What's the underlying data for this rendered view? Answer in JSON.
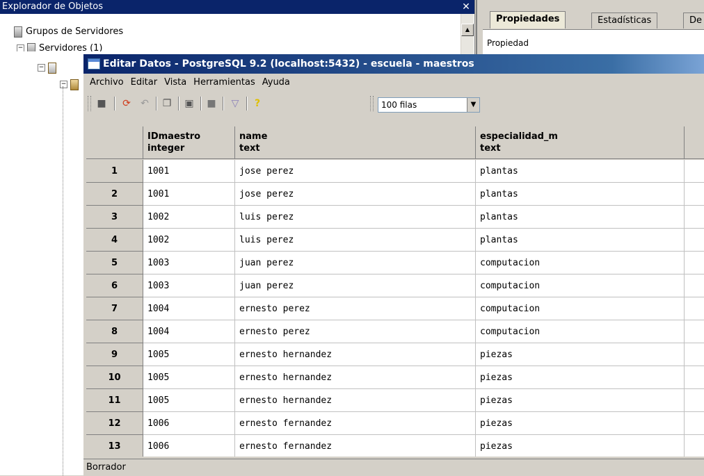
{
  "explorer": {
    "title": "Explorador de Objetos",
    "close_glyph": "✕",
    "tree": [
      {
        "label": "Grupos de Servidores"
      },
      {
        "label": "Servidores (1)"
      }
    ]
  },
  "properties": {
    "tabs": [
      "Propiedades",
      "Estadísticas",
      "De"
    ],
    "header": "Propiedad"
  },
  "editor": {
    "title": "Editar Datos - PostgreSQL 9.2 (localhost:5432) - escuela - maestros",
    "menu": [
      "Archivo",
      "Editar",
      "Vista",
      "Herramientas",
      "Ayuda"
    ],
    "toolbar": {
      "rows_limit": "100 filas"
    },
    "columns": [
      {
        "name": "IDmaestro",
        "type": "integer"
      },
      {
        "name": "name",
        "type": "text"
      },
      {
        "name": "especialidad_m",
        "type": "text"
      }
    ],
    "rows": [
      {
        "num": "1",
        "id": "1001",
        "name": "jose perez",
        "esp": "plantas"
      },
      {
        "num": "2",
        "id": "1001",
        "name": "jose perez",
        "esp": "plantas"
      },
      {
        "num": "3",
        "id": "1002",
        "name": "luis perez",
        "esp": "plantas"
      },
      {
        "num": "4",
        "id": "1002",
        "name": "luis perez",
        "esp": "plantas"
      },
      {
        "num": "5",
        "id": "1003",
        "name": "juan perez",
        "esp": "computacion"
      },
      {
        "num": "6",
        "id": "1003",
        "name": "juan perez",
        "esp": "computacion"
      },
      {
        "num": "7",
        "id": "1004",
        "name": "ernesto perez",
        "esp": "computacion"
      },
      {
        "num": "8",
        "id": "1004",
        "name": "ernesto perez",
        "esp": "computacion"
      },
      {
        "num": "9",
        "id": "1005",
        "name": "ernesto hernandez",
        "esp": "piezas"
      },
      {
        "num": "10",
        "id": "1005",
        "name": "ernesto hernandez",
        "esp": "piezas"
      },
      {
        "num": "11",
        "id": "1005",
        "name": "ernesto hernandez",
        "esp": "piezas"
      },
      {
        "num": "12",
        "id": "1006",
        "name": "ernesto fernandez",
        "esp": "piezas"
      },
      {
        "num": "13",
        "id": "1006",
        "name": "ernesto fernandez",
        "esp": "piezas"
      }
    ],
    "status": "Borrador"
  }
}
